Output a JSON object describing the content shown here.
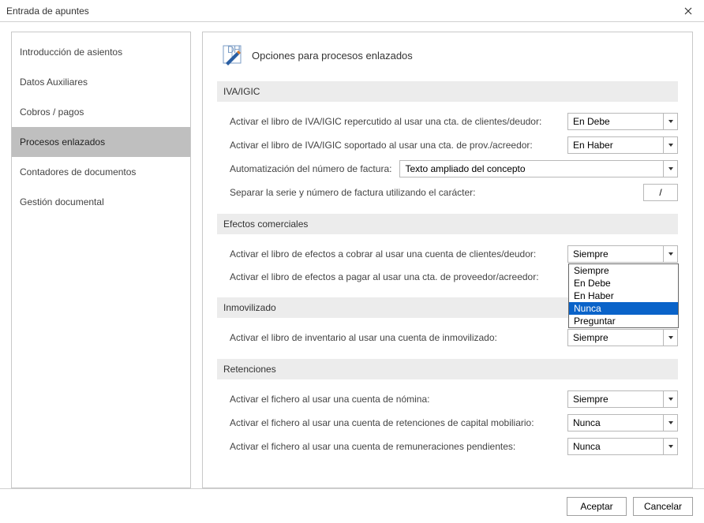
{
  "window": {
    "title": "Entrada de apuntes"
  },
  "sidebar": {
    "items": [
      {
        "label": "Introducción de asientos"
      },
      {
        "label": "Datos Auxiliares"
      },
      {
        "label": "Cobros / pagos"
      },
      {
        "label": "Procesos enlazados"
      },
      {
        "label": "Contadores de documentos"
      },
      {
        "label": "Gestión documental"
      }
    ],
    "selected_index": 3
  },
  "page": {
    "title": "Opciones para procesos enlazados"
  },
  "sections": {
    "iva": {
      "title": "IVA/IGIC",
      "rows": {
        "repercutido": {
          "label": "Activar el libro de IVA/IGIC repercutido al usar una cta. de clientes/deudor:",
          "value": "En Debe"
        },
        "soportado": {
          "label": "Activar el libro de IVA/IGIC soportado al usar una cta. de prov./acreedor:",
          "value": "En Haber"
        },
        "automat": {
          "label": "Automatización del número de factura:",
          "value": "Texto ampliado del concepto"
        },
        "separar": {
          "label": "Separar la serie y número de factura utilizando el carácter:",
          "value": "/"
        }
      }
    },
    "efectos": {
      "title": "Efectos comerciales",
      "rows": {
        "cobrar": {
          "label": "Activar el libro de efectos a cobrar al usar una cuenta de clientes/deudor:",
          "value": "Siempre"
        },
        "pagar": {
          "label": "Activar el libro de efectos a pagar al usar una cta. de proveedor/acreedor:",
          "value": ""
        }
      }
    },
    "inmov": {
      "title": "Inmovilizado",
      "rows": {
        "inventario": {
          "label": "Activar el libro de inventario al usar una cuenta de inmovilizado:",
          "value": "Siempre"
        }
      }
    },
    "retenciones": {
      "title": "Retenciones",
      "rows": {
        "nomina": {
          "label": "Activar el fichero al usar una cuenta de nómina:",
          "value": "Siempre"
        },
        "capital": {
          "label": "Activar el fichero al usar una cuenta de retenciones de capital mobiliario:",
          "value": "Nunca"
        },
        "remun": {
          "label": "Activar el fichero al usar una cuenta de remuneraciones pendientes:",
          "value": "Nunca"
        }
      }
    }
  },
  "dropdown_open": {
    "options": [
      "Siempre",
      "En Debe",
      "En Haber",
      "Nunca",
      "Preguntar"
    ],
    "highlighted": "Nunca"
  },
  "footer": {
    "accept": "Aceptar",
    "cancel": "Cancelar"
  }
}
